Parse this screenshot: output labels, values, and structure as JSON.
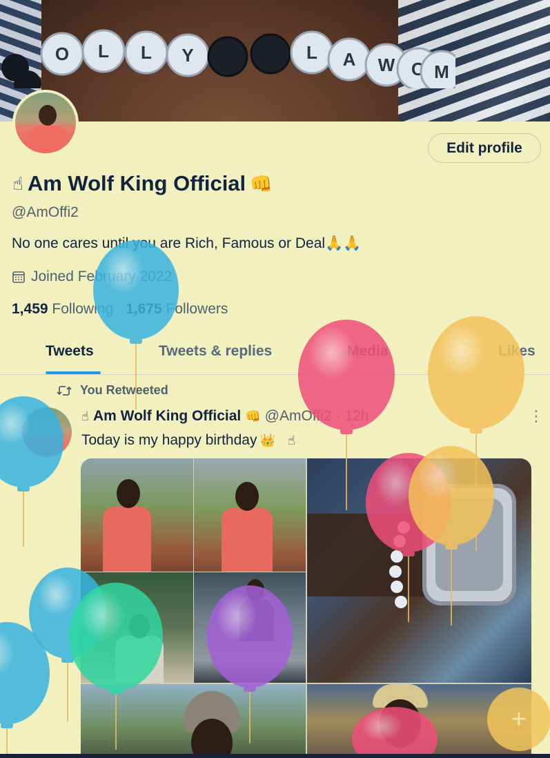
{
  "profile": {
    "display_name": "Am Wolf King Official",
    "handle": "@AmOffi2",
    "bio": "No one cares until you are Rich, Famous or Deal🙏🙏",
    "joined": "Joined February 2022",
    "following_count": "1,459",
    "following_label": "Following",
    "followers_count": "1,675",
    "followers_label": "Followers",
    "edit_button": "Edit profile"
  },
  "tabs": [
    {
      "label": "Tweets",
      "active": true
    },
    {
      "label": "Tweets & replies",
      "active": false
    },
    {
      "label": "Media",
      "active": false
    },
    {
      "label": "Likes",
      "active": false
    }
  ],
  "tweet": {
    "retweet_label": "You Retweeted",
    "author_name": "Am Wolf King Official",
    "author_handle": "@AmOffi2",
    "time": "12h",
    "separator": "·",
    "text": "Today is my happy birthday",
    "more": "⋮"
  },
  "banner": {
    "bead_letters": [
      "O",
      "L",
      "L",
      "Y",
      "",
      "",
      "L",
      "A",
      "W",
      "O",
      "M"
    ]
  },
  "icons": {
    "pointing_hand": "☝",
    "fist": "👊",
    "crown": "👑",
    "calendar": "calendar-icon",
    "retweet": "retweet-icon",
    "plus": "+"
  },
  "colors": {
    "background": "#f3f0bf",
    "text": "#10233f",
    "muted": "#4f5f6e",
    "accent": "#1d9bf0",
    "balloon_blue": "#38b3e0",
    "balloon_pink": "#ef4f7a",
    "balloon_yellow": "#f3c25a",
    "balloon_green": "#2fd7a0",
    "balloon_purple": "#a460d8"
  }
}
